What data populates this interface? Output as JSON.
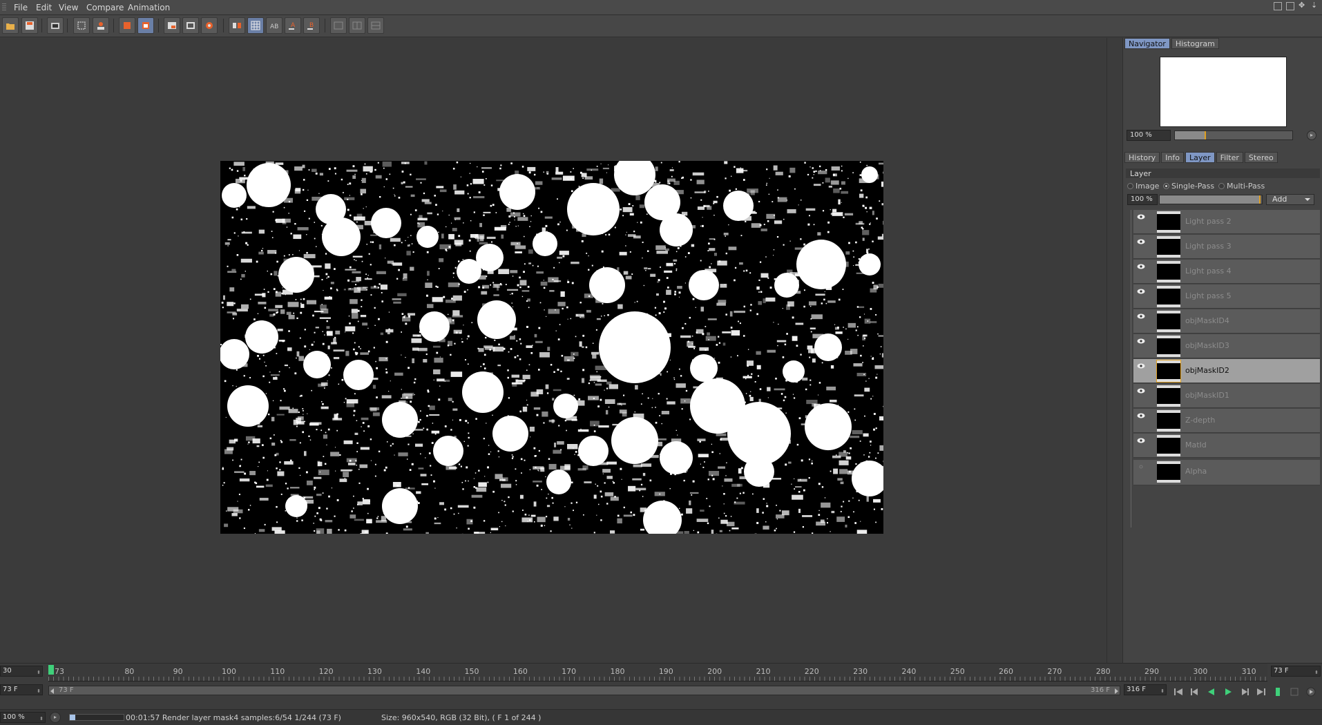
{
  "menu": [
    "File",
    "Edit",
    "View",
    "Compare",
    "Animation"
  ],
  "toolbar": {
    "buttons": [
      "open-icon",
      "save-icon",
      "render-icon",
      "region-icon",
      "user-icon",
      "layers-icon",
      "layer-stack-icon",
      "view-a-icon",
      "view-b-icon",
      "view-c-icon",
      "compare-icon",
      "grid-icon",
      "ab-icon",
      "marker-a-icon",
      "marker-b-icon",
      "split-1-icon",
      "split-2-icon",
      "split-3-icon"
    ]
  },
  "nav_tabs": [
    {
      "label": "Navigator",
      "active": true
    },
    {
      "label": "Histogram",
      "active": false
    }
  ],
  "navigator": {
    "zoom": "100 %"
  },
  "panel_tabs": [
    {
      "label": "History",
      "active": false
    },
    {
      "label": "Info",
      "active": false
    },
    {
      "label": "Layer",
      "active": true
    },
    {
      "label": "Filter",
      "active": false
    },
    {
      "label": "Stereo",
      "active": false
    }
  ],
  "layer_panel": {
    "section_label": "Layer",
    "modes": [
      {
        "label": "Image",
        "selected": false
      },
      {
        "label": "Single-Pass",
        "selected": true
      },
      {
        "label": "Multi-Pass",
        "selected": false
      }
    ],
    "opacity": "100 %",
    "opacity_fraction": 1.0,
    "add_label": "Add"
  },
  "layers": [
    {
      "name": "Light pass 2",
      "visible": true,
      "selected": false
    },
    {
      "name": "Light pass 3",
      "visible": true,
      "selected": false
    },
    {
      "name": "Light pass 4",
      "visible": true,
      "selected": false
    },
    {
      "name": "Light pass 5",
      "visible": true,
      "selected": false
    },
    {
      "name": "objMaskID4",
      "visible": true,
      "selected": false
    },
    {
      "name": "objMaskID3",
      "visible": true,
      "selected": false
    },
    {
      "name": "objMaskID2",
      "visible": true,
      "selected": true
    },
    {
      "name": "objMaskID1",
      "visible": true,
      "selected": false
    },
    {
      "name": "Z-depth",
      "visible": true,
      "selected": false
    },
    {
      "name": "MatId",
      "visible": true,
      "selected": false
    },
    {
      "name": "Alpha",
      "visible": false,
      "selected": false
    }
  ],
  "timeline": {
    "fps": "30",
    "current_frame": "73 F",
    "start_frame": "73 F",
    "end_frame": "316 F",
    "range_end_label": "316 F",
    "right_frame": "73 F",
    "end_field": "316 F",
    "playhead_label": "73",
    "ruler_labels": [
      "80",
      "90",
      "100",
      "110",
      "120",
      "130",
      "140",
      "150",
      "160",
      "170",
      "180",
      "190",
      "200",
      "210",
      "220",
      "230",
      "240",
      "250",
      "260",
      "270",
      "280",
      "290",
      "300",
      "310"
    ],
    "ruler_values": [
      80,
      90,
      100,
      110,
      120,
      130,
      140,
      150,
      160,
      170,
      180,
      190,
      200,
      210,
      220,
      230,
      240,
      250,
      260,
      270,
      280,
      290,
      300,
      310
    ],
    "ruler_min": 70,
    "ruler_max": 321
  },
  "status": {
    "zoom": "100 %",
    "render_text": "00:01:57 Render layer mask4 samples:6/54 1/244 (73 F)",
    "size_text": "Size: 960x540, RGB (32 Bit),  ( F 1 of 244 )",
    "progress_fraction": 0.1
  },
  "colors": {
    "accent_tab": "#7f97c4",
    "playhead": "#3fd07a",
    "toolbar_orange": "#e8622c",
    "selection_outline": "#e0a020"
  }
}
